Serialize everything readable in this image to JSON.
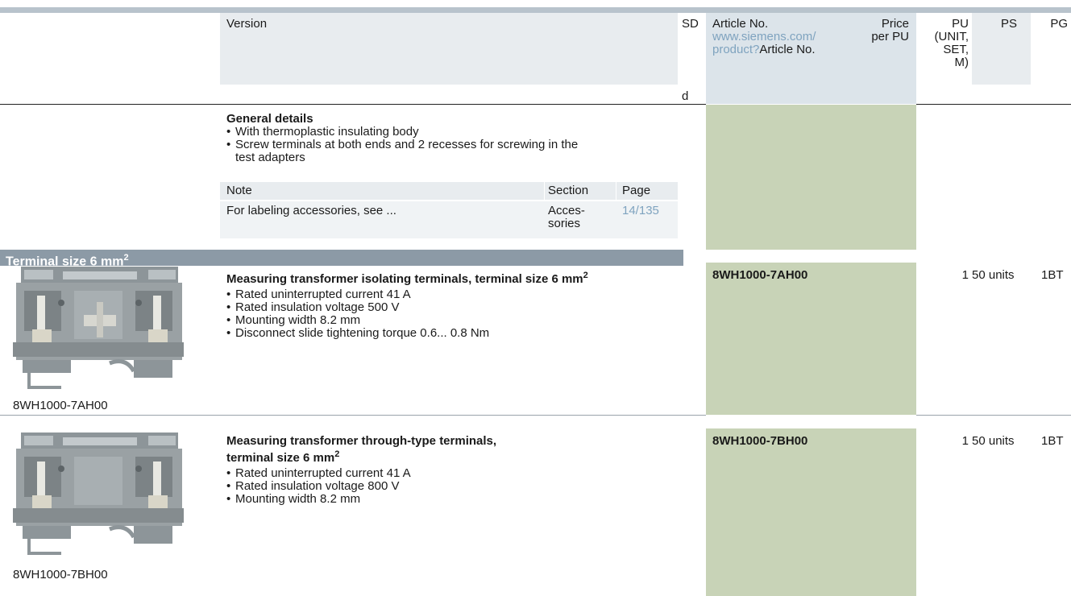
{
  "header": {
    "version": "Version",
    "sd": "SD",
    "d": "d",
    "article_no": "Article No.",
    "article_link": "www.siemens.com/",
    "article_link2": "product?",
    "article_link2_suffix": "Article No.",
    "price": "Price",
    "price2": "per PU",
    "pu": [
      "PU",
      "(UNIT,",
      "SET,",
      "M)"
    ],
    "ps": "PS",
    "pg": "PG"
  },
  "general": {
    "title": "General details",
    "bullets": [
      "With thermoplastic insulating body",
      "Screw terminals at both ends and 2 recesses for screwing in the",
      "test adapters"
    ],
    "note_table": {
      "headers": [
        "Note",
        "Section",
        "Page"
      ],
      "row": [
        "For labeling accessories, see ...",
        "Acces-",
        "sories",
        "14/135"
      ]
    }
  },
  "section": {
    "title": "Terminal size 6 mm",
    "sup": "2"
  },
  "products": [
    {
      "title": "Measuring transformer isolating terminals, terminal size 6 mm",
      "title_sup": "2",
      "bullets": [
        "Rated uninterrupted current 41 A",
        "Rated insulation voltage 500 V",
        "Mounting width 8.2 mm",
        "Disconnect slide tightening torque 0.6... 0.8 Nm"
      ],
      "article": "8WH1000-7AH00",
      "pu": "1",
      "ps": "50 units",
      "pg": "1BT",
      "caption": "8WH1000-7AH00"
    },
    {
      "title": "Measuring transformer through-type terminals,",
      "title2": "terminal size 6 mm",
      "title_sup": "2",
      "bullets": [
        "Rated uninterrupted current 41 A",
        "Rated insulation voltage 800 V",
        "Mounting width 8.2 mm"
      ],
      "article": "8WH1000-7BH00",
      "pu": "1",
      "ps": "50 units",
      "pg": "1BT",
      "caption": "8WH1000-7BH00"
    }
  ]
}
